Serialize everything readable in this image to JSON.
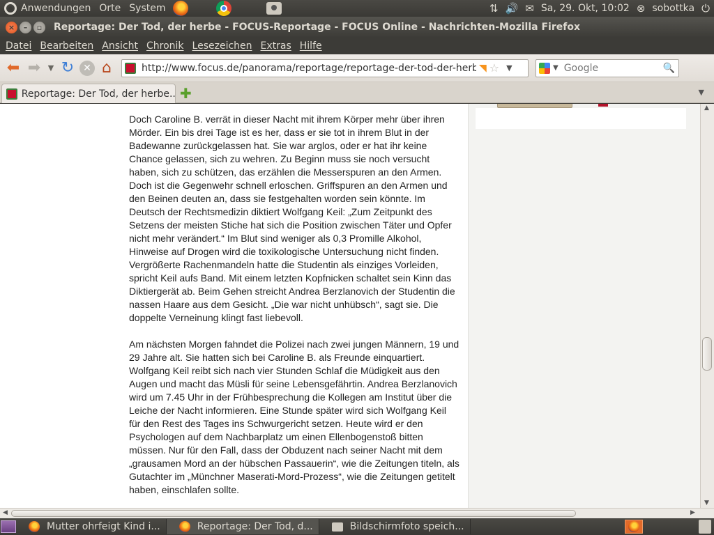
{
  "top_panel": {
    "apps": "Anwendungen",
    "places": "Orte",
    "system": "System",
    "datetime": "Sa, 29. Okt, 10:02",
    "user": "sobottka"
  },
  "window": {
    "title": "Reportage: Der Tod, der herbe - FOCUS-Reportage - FOCUS Online - Nachrichten-Mozilla Firefox"
  },
  "menubar": [
    "Datei",
    "Bearbeiten",
    "Ansicht",
    "Chronik",
    "Lesezeichen",
    "Extras",
    "Hilfe"
  ],
  "navbar": {
    "url": "http://www.focus.de/panorama/reportage/reportage-der-tod-der-herbe_",
    "search_placeholder": "Google"
  },
  "tab": {
    "label": "Reportage: Der Tod, der herbe..."
  },
  "article": {
    "paragraphs": [
      "Doch Caroline B. verrät in dieser Nacht mit ihrem Körper mehr über ihren Mörder. Ein bis drei Tage ist es her, dass er sie tot in ihrem Blut in der Badewanne zurückgelassen hat. Sie war arglos, oder er hat ihr keine Chance gelassen, sich zu wehren. Zu Beginn muss sie noch versucht haben, sich zu schützen, das erzählen die Messerspuren an den Armen. Doch ist die Gegenwehr schnell erloschen. Griffspuren an den Armen und den Beinen deuten an, dass sie festgehalten worden sein könnte. Im Deutsch der Rechtsmedizin diktiert Wolfgang Keil: „Zum Zeitpunkt des Setzens der meisten Stiche hat sich die Position zwischen Täter und Opfer nicht mehr verändert.“ Im Blut sind weniger als 0,3 Promille Alkohol, Hinweise auf Drogen wird die toxikologische Untersuchung nicht finden. Vergrößerte Rachenmandeln hatte die Studentin als einziges Vorleiden, spricht Keil aufs Band. Mit einem letzten Kopfnicken schaltet sein Kinn das Diktiergerät ab. Beim Gehen streicht Andrea Berzlanovich der Studentin die nassen Haare aus dem Gesicht. „Die war nicht unhübsch“, sagt sie. Die doppelte Verneinung klingt fast liebevoll.",
      "Am nächsten Morgen fahndet die Polizei nach zwei jungen Männern, 19 und 29 Jahre alt. Sie hatten sich bei Caroline B. als Freunde einquartiert. Wolfgang Keil reibt sich nach vier Stunden Schlaf die Müdigkeit aus den Augen und macht das Müsli für seine Lebensgefährtin. Andrea Berzlanovich wird um 7.45 Uhr in der Frühbesprechung die Kollegen am Institut über die Leiche der Nacht informieren. Eine Stunde später wird sich Wolfgang Keil für den Rest des Tages ins Schwurgericht setzen. Heute wird er den Psychologen auf dem Nachbarplatz um einen Ellenbogenstoß bitten müssen. Nur für den Fall, dass der Obduzent nach seiner Nacht mit dem „grausamen Mord an der hübschen Passauerin“, wie die Zeitungen titeln, als Gutachter im „Münchner Maserati-Mord-Prozess“, wie die Zeitungen getitelt haben, einschlafen sollte."
    ]
  },
  "taskbar": {
    "tasks": [
      "Mutter ohrfeigt Kind i...",
      "Reportage: Der Tod, d...",
      "Bildschirmfoto speich..."
    ]
  },
  "icons": {
    "back": "back-arrow-icon",
    "forward": "forward-arrow-icon",
    "reload": "reload-icon",
    "stop": "stop-icon",
    "home": "home-icon"
  },
  "colors": {
    "panel": "#3c3b37",
    "accent_close": "#e2531b"
  }
}
